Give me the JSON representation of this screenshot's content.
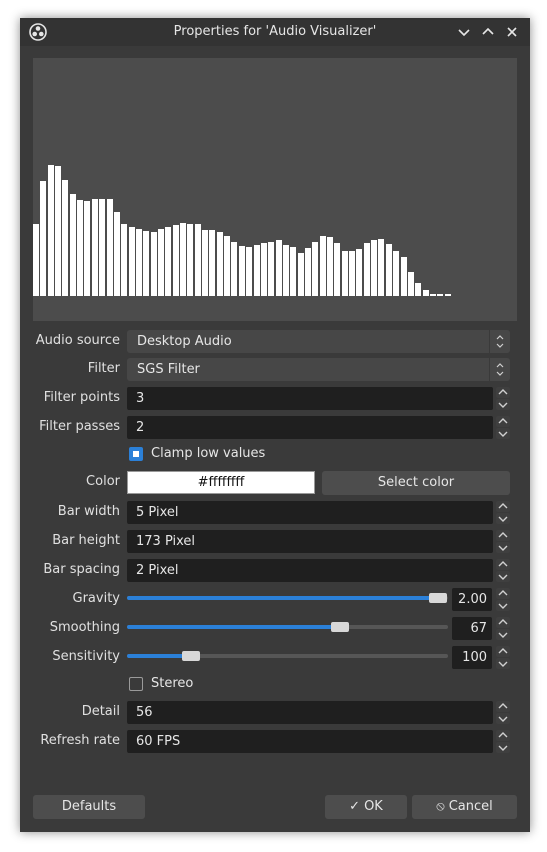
{
  "window": {
    "title": "Properties for 'Audio Visualizer'"
  },
  "visualizer": {
    "bar_color": "#ffffff",
    "background_color": "#4c4c4c",
    "bar_levels": [
      72,
      115,
      131,
      130,
      116,
      102,
      96,
      95,
      97,
      97,
      97,
      84,
      72,
      69,
      67,
      65,
      64,
      67,
      69,
      71,
      73,
      72,
      72,
      66,
      66,
      64,
      60,
      54,
      50,
      49,
      51,
      53,
      54,
      56,
      51,
      49,
      43,
      48,
      54,
      60,
      59,
      53,
      45,
      45,
      47,
      53,
      56,
      57,
      52,
      45,
      39,
      24,
      13,
      6,
      2,
      2,
      2
    ]
  },
  "fields": {
    "audio_source": {
      "label": "Audio source",
      "value": "Desktop Audio"
    },
    "filter": {
      "label": "Filter",
      "value": "SGS Filter"
    },
    "filter_points": {
      "label": "Filter points",
      "value": "3"
    },
    "filter_passes": {
      "label": "Filter passes",
      "value": "2"
    },
    "clamp_low_values": {
      "label": "Clamp low values",
      "checked": true
    },
    "color": {
      "label": "Color",
      "value": "#ffffffff",
      "button": "Select color"
    },
    "bar_width": {
      "label": "Bar width",
      "value": "5 Pixel"
    },
    "bar_height": {
      "label": "Bar height",
      "value": "173 Pixel"
    },
    "bar_spacing": {
      "label": "Bar spacing",
      "value": "2 Pixel"
    },
    "gravity": {
      "label": "Gravity",
      "value": "2.00",
      "fraction": 0.97
    },
    "smoothing": {
      "label": "Smoothing",
      "value": "67",
      "fraction": 0.665
    },
    "sensitivity": {
      "label": "Sensitivity",
      "value": "100",
      "fraction": 0.2
    },
    "stereo": {
      "label": "Stereo",
      "checked": false
    },
    "detail": {
      "label": "Detail",
      "value": "56"
    },
    "refresh_rate": {
      "label": "Refresh rate",
      "value": "60 FPS"
    }
  },
  "buttons": {
    "defaults": "Defaults",
    "ok": "OK",
    "cancel": "Cancel"
  },
  "icons": {
    "app": "obs-logo-icon",
    "minimize": "chevron-down-icon",
    "maximize": "chevron-up-icon",
    "close": "close-icon",
    "ok": "checkmark-icon",
    "cancel": "cancel-circle-icon"
  },
  "accent": "#2b80d8"
}
